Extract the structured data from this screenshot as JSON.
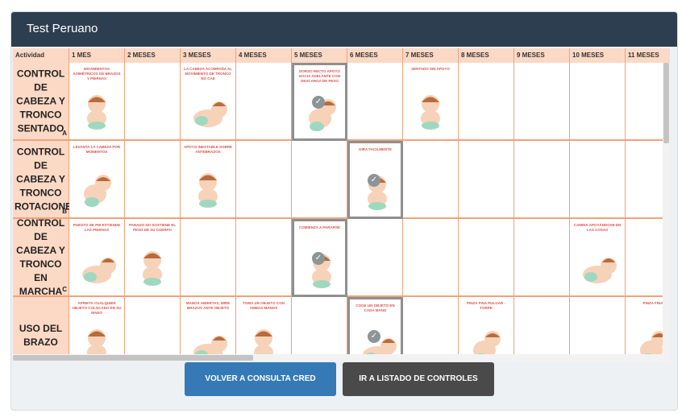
{
  "header": {
    "title": "Test Peruano"
  },
  "table": {
    "columns": [
      "Actividad",
      "1 MES",
      "2 MESES",
      "3 MESES",
      "4 MESES",
      "5 MESES",
      "6 MESES",
      "7 MESES",
      "8 MESES",
      "9 MESES",
      "10 MESES",
      "11 MESES"
    ],
    "rows": [
      {
        "label": "CONTROL DE CABEZA Y TRONCO SENTADO",
        "letter": "A",
        "cells": [
          {
            "col": 1,
            "caption": "MOVIMIENTOS ASIMÉTRICOS DE BRAZOS Y PIERNAS"
          },
          {
            "col": 3,
            "caption": "LA CABEZA ACOMPAÑA AL MOVIMIENTO DE TRONCO NO CAE"
          },
          {
            "col": 5,
            "caption": "DORSO RECTO APOYO HACIA ADELANTE CON DESCARGA DE PESO",
            "selected": true
          },
          {
            "col": 7,
            "caption": "SENTADO SIN APOYO"
          }
        ]
      },
      {
        "label": "CONTROL DE CABEZA Y TRONCO ROTACIONES",
        "letter": "B",
        "cells": [
          {
            "col": 1,
            "caption": "LEVANTA LA CABEZA POR MOMENTOS"
          },
          {
            "col": 3,
            "caption": "APOYO INESTABLE SOBRE ANTEBRAZOS"
          },
          {
            "col": 6,
            "caption": "GIRA FACILMENTE",
            "selected": true
          }
        ]
      },
      {
        "label": "CONTROL DE CABEZA Y TRONCO EN MARCHA",
        "letter": "C",
        "cells": [
          {
            "col": 1,
            "caption": "PUESTO DE PIE EXTIENDE LAS PIERNAS"
          },
          {
            "col": 2,
            "caption": "PARADO NO SOSTIENE EL PESO DE SU CUERPO"
          },
          {
            "col": 5,
            "caption": "COMIENZA A PARARSE",
            "selected": true
          },
          {
            "col": 10,
            "caption": "CAMINA APOYÁNDOSE EN LAS COSAS"
          }
        ]
      },
      {
        "label": "USO DEL BRAZO",
        "letter": "",
        "cells": [
          {
            "col": 1,
            "caption": "APRIETA CUALQUIER OBJETO COLOCADO EN SU MANO"
          },
          {
            "col": 3,
            "caption": "MANOS ABIERTAS, MIRE BRAZOS ANTE OBJETO"
          },
          {
            "col": 4,
            "caption": "TOMA UN OBJETO CON AMBAS MANOS"
          },
          {
            "col": 6,
            "caption": "COGE UN OBJETO EN CADA MANO",
            "selected": true
          },
          {
            "col": 8,
            "caption": "PINZA FINA PULGAR - TORPE"
          },
          {
            "col": 11,
            "caption": "PINZA FINA"
          }
        ]
      }
    ]
  },
  "buttons": {
    "back_label": "VOLVER A CONSULTA CRED",
    "list_label": "IR A LISTADO DE CONTROLES"
  },
  "colors": {
    "header_bg": "#2e3e51",
    "table_header_bg": "#fcd9c5",
    "grid_line": "#f1a27b",
    "primary_button": "#357ab6",
    "dark_button": "#4a4a4a",
    "caption_text": "#d9534f"
  }
}
